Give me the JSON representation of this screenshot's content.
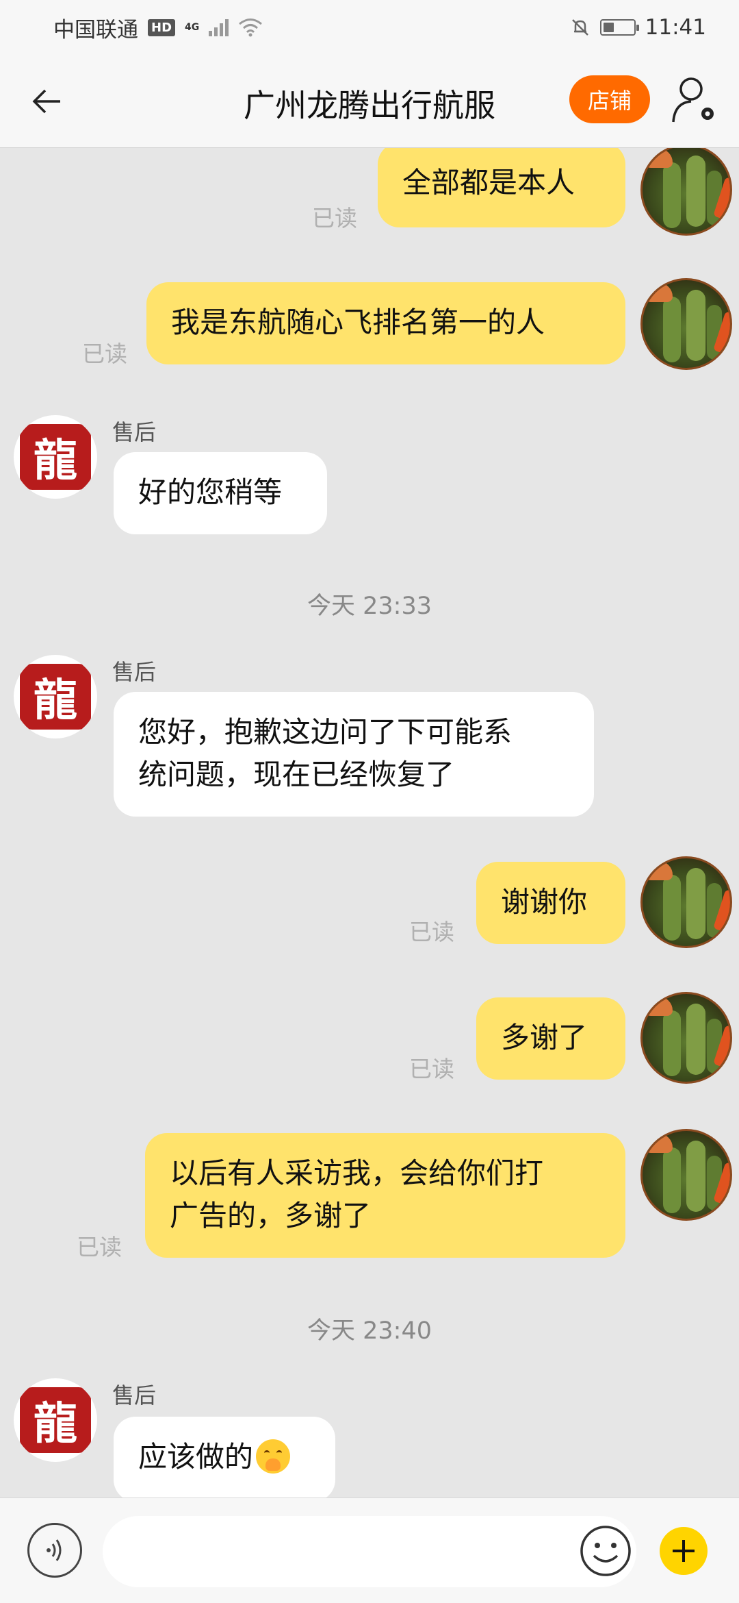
{
  "status_bar": {
    "carrier": "中国联通",
    "hd": "HD",
    "network": "4G",
    "time": "11:41",
    "battery_level": 0.35
  },
  "header": {
    "title": "广州龙腾出行航服",
    "shop_button": "店铺"
  },
  "avatars": {
    "seller_icon": "dragon-seal-avatar",
    "self_icon": "cactus-avatar"
  },
  "messages": [
    {
      "side": "me",
      "text": "全部都是本人",
      "status": "已读"
    },
    {
      "side": "me",
      "text": "我是东航随心飞排名第一的人",
      "status": "已读"
    },
    {
      "side": "them",
      "sender": "售后",
      "text": "好的您稍等"
    },
    {
      "time": "今天 23:33"
    },
    {
      "side": "them",
      "sender": "售后",
      "lines": [
        "您好，抱歉这边问了下可能系",
        "统问题，现在已经恢复了"
      ]
    },
    {
      "side": "me",
      "text": "谢谢你",
      "status": "已读"
    },
    {
      "side": "me",
      "text": "多谢了",
      "status": "已读"
    },
    {
      "side": "me",
      "lines": [
        "以后有人采访我，会给你们打",
        "广告的，多谢了"
      ],
      "status": "已读"
    },
    {
      "time": "今天 23:40"
    },
    {
      "side": "them",
      "sender": "售后",
      "text": "应该做的",
      "emoji": "shy-face-emoji"
    }
  ],
  "input_bar": {
    "placeholder": "",
    "icons": [
      "voice-icon",
      "emoji-icon",
      "plus-icon"
    ]
  },
  "colors": {
    "my_bubble": "#ffe36c",
    "their_bubble": "#ffffff",
    "accent": "#ff6a00",
    "plus": "#ffd400"
  }
}
